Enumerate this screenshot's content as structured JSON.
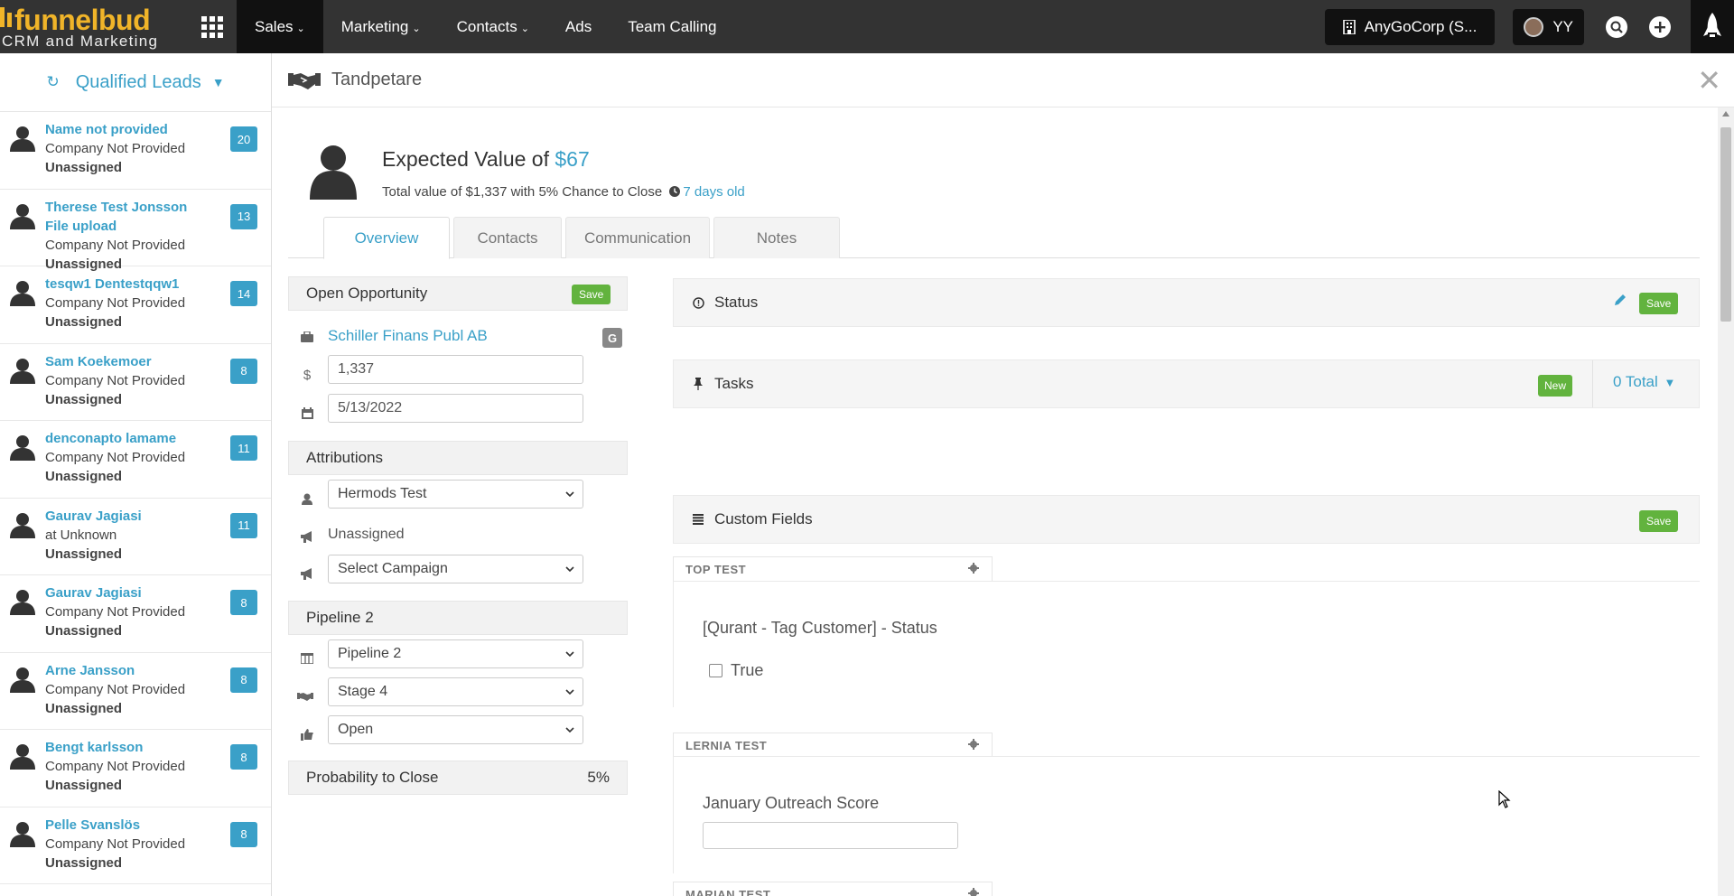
{
  "brand": {
    "name": "funnelbud",
    "tagline": "CRM and Marketing"
  },
  "nav": {
    "items": [
      {
        "label": "Sales",
        "active": true,
        "has_caret": true
      },
      {
        "label": "Marketing",
        "active": false,
        "has_caret": true
      },
      {
        "label": "Contacts",
        "active": false,
        "has_caret": true
      },
      {
        "label": "Ads",
        "active": false,
        "has_caret": false
      },
      {
        "label": "Team Calling",
        "active": false,
        "has_caret": false
      }
    ],
    "org_label": "AnyGoCorp (S...",
    "user_initials": "YY"
  },
  "sidebar": {
    "title": "Qualified Leads",
    "leads": [
      {
        "name": "Name not provided",
        "name2": "",
        "company": "Company Not Provided",
        "owner": "Unassigned",
        "count": "20"
      },
      {
        "name": "Therese Test Jonsson",
        "name2": "File upload",
        "company": "Company Not Provided",
        "owner": "Unassigned",
        "count": "13"
      },
      {
        "name": "tesqw1 Dentestqqw1",
        "name2": "",
        "company": "Company Not Provided",
        "owner": "Unassigned",
        "count": "14"
      },
      {
        "name": "Sam Koekemoer",
        "name2": "",
        "company": "Company Not Provided",
        "owner": "Unassigned",
        "count": "8"
      },
      {
        "name": "denconapto lamame",
        "name2": "",
        "company": "Company Not Provided",
        "owner": "Unassigned",
        "count": "11"
      },
      {
        "name": "Gaurav Jagiasi",
        "name2": "",
        "company": "at Unknown",
        "owner": "Unassigned",
        "count": "11"
      },
      {
        "name": "Gaurav Jagiasi",
        "name2": "",
        "company": "Company Not Provided",
        "owner": "Unassigned",
        "count": "8"
      },
      {
        "name": "Arne Jansson",
        "name2": "",
        "company": "Company Not Provided",
        "owner": "Unassigned",
        "count": "8"
      },
      {
        "name": "Bengt karlsson",
        "name2": "",
        "company": "Company Not Provided",
        "owner": "Unassigned",
        "count": "8"
      },
      {
        "name": "Pelle Svanslös",
        "name2": "",
        "company": "Company Not Provided",
        "owner": "Unassigned",
        "count": "8"
      }
    ]
  },
  "deal": {
    "title": "Tandpetare",
    "expected_prefix": "Expected Value of ",
    "expected_value": "$67",
    "total_line": "Total value of $1,337 with 5% Chance to Close",
    "age": "7 days old"
  },
  "tabs": [
    {
      "label": "Overview",
      "active": true
    },
    {
      "label": "Contacts",
      "active": false
    },
    {
      "label": "Communication",
      "active": false
    },
    {
      "label": "Notes",
      "active": false
    }
  ],
  "opportunity": {
    "heading": "Open Opportunity",
    "save_label": "Save",
    "company": "Schiller Finans Publ AB",
    "currency_symbol": "$",
    "amount": "1,337",
    "close_date": "5/13/2022"
  },
  "attributions": {
    "heading": "Attributions",
    "owner": "Hermods Test",
    "source": "Unassigned",
    "campaign": "Select Campaign"
  },
  "pipeline": {
    "heading": "Pipeline 2",
    "pipeline": "Pipeline 2",
    "stage": "Stage 4",
    "state": "Open"
  },
  "probability": {
    "heading": "Probability to Close",
    "value": "5%"
  },
  "status_panel": {
    "label": "Status",
    "save_label": "Save"
  },
  "tasks_panel": {
    "label": "Tasks",
    "new_label": "New",
    "total_label": "0 Total"
  },
  "custom_fields": {
    "label": "Custom Fields",
    "save_label": "Save",
    "sections": [
      {
        "title": "TOP TEST",
        "field_label": "[Qurant - Tag Customer] - Status",
        "option_label": "True"
      },
      {
        "title": "LERNIA TEST",
        "field_label": "January Outreach Score"
      },
      {
        "title": "MARIAN TEST"
      }
    ]
  },
  "colors": {
    "accent": "#3aa0c8",
    "save_green": "#62b33e",
    "topbar": "#333333",
    "brand_yellow": "#f0b429"
  }
}
